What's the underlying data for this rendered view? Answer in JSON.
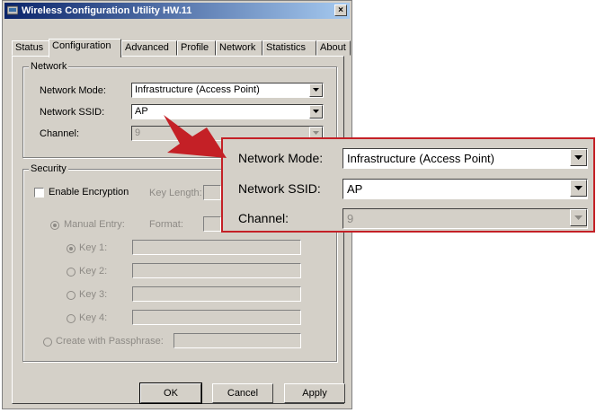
{
  "window": {
    "title": "Wireless Configuration Utility HW.11",
    "close_glyph": "×"
  },
  "tabs": [
    "Status",
    "Configuration",
    "Advanced",
    "Profile",
    "Network",
    "Statistics",
    "About"
  ],
  "active_tab": "Configuration",
  "network": {
    "legend": "Network",
    "mode_label": "Network Mode:",
    "mode_value": "Infrastructure (Access Point)",
    "ssid_label": "Network SSID:",
    "ssid_value": "AP",
    "channel_label": "Channel:",
    "channel_value": "9"
  },
  "security": {
    "legend": "Security",
    "enable_label": "Enable Encryption",
    "key_length_label": "Key Length:",
    "manual_entry_label": "Manual Entry:",
    "format_label": "Format:",
    "keys": [
      "Key 1:",
      "Key 2:",
      "Key 3:",
      "Key 4:"
    ],
    "passphrase_label": "Create with Passphrase:"
  },
  "buttons": {
    "ok": "OK",
    "cancel": "Cancel",
    "apply": "Apply"
  },
  "zoom": {
    "mode_label": "Network Mode:",
    "mode_value": "Infrastructure (Access Point)",
    "ssid_label": "Network SSID:",
    "ssid_value": "AP",
    "channel_label": "Channel:",
    "channel_value": "9"
  },
  "colors": {
    "callout": "#c42026",
    "dialog": "#d4d0c8",
    "titlebar": "#0a246a"
  }
}
